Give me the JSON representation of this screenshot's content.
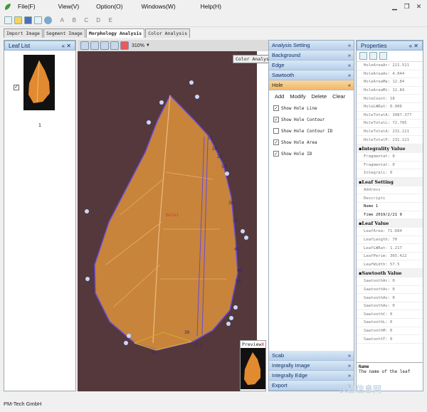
{
  "menu": [
    "File(F)",
    "View(V)",
    "Option(O)",
    "Windows(W)",
    "Help(H)"
  ],
  "toolbar_letters": [
    "A",
    "B",
    "C",
    "D",
    "E"
  ],
  "tabs": [
    "Import Image",
    "Segment Image",
    "Morphology Analysis",
    "Color Analysis"
  ],
  "leaf_list": {
    "title": "Leaf List",
    "item_label": "1",
    "checked": "✓"
  },
  "viewer": {
    "zoom": "310%",
    "color_analysis_button": "Color Analysis",
    "hole_label": "Hole1",
    "preview_title": "Preview",
    "preview_close": "X",
    "contour_numbers": [
      "27",
      "28",
      "29",
      "30",
      "36",
      "37",
      "42",
      "44",
      "50",
      "3",
      "2",
      "30",
      "33"
    ]
  },
  "analysis_setting": {
    "title": "Analysis Setting",
    "sections_top": [
      "Background",
      "Edge",
      "Sawtooth",
      "Hole"
    ],
    "actions": [
      "Add",
      "Modify",
      "Delete",
      "Clear"
    ],
    "checks": [
      {
        "label": "Show Hole Line",
        "checked": true
      },
      {
        "label": "Show Hole Contour",
        "checked": true
      },
      {
        "label": "Show Hole Contour ID",
        "checked": false
      },
      {
        "label": "Show Hole Area",
        "checked": true
      },
      {
        "label": "Show Hole ID",
        "checked": true
      }
    ],
    "sections_bottom": [
      "Scab",
      "Integrally Image",
      "Integrally Edge",
      "Export"
    ]
  },
  "properties": {
    "title": "Properties",
    "rows_top": [
      "HoleAreaAr: 221.521",
      "HoleAreaAv: 4.044",
      "HoleAreaMa: 12.84",
      "HoleAreaMi: 12.84",
      "HoleCount: 18",
      "HoleLWRat: 0.906",
      "HoleTotalA: 3987.377",
      "HoleTotalL: 72.785",
      "HoleTotalA: 231.121",
      "HoleTotalP: 231.121"
    ],
    "cat_integrality": "Integrality Value",
    "rows_integrality": [
      "Fragmentat: 0",
      "Fragmentat: 0",
      "Integrali: 0"
    ],
    "cat_leaf_setting": "Leaf Setting",
    "rows_leaf_setting": [
      "Address",
      "Descripti",
      "Name      1",
      "Time      2019/2/21 9"
    ],
    "cat_leaf_value": "Leaf Value",
    "rows_leaf_value": [
      "LeafArea: 71.684",
      "LeafLength: 70",
      "LeafLWRat: 1.217",
      "LeafPerim: 365.422",
      "LeafWidth: 57.5"
    ],
    "cat_sawtooth": "Sawtooth Value",
    "rows_sawtooth": [
      "SawtoothAr: 0",
      "SawtoothAv: 0",
      "SawtoothAv: 0",
      "SawtoothAv: 0",
      "SawtoothC: 0",
      "SawtoothL: 0",
      "SawtoothM: 0",
      "SawtoothT: 0"
    ],
    "desc_title": "Name",
    "desc_text": "The name of the leaf"
  },
  "status": "PM-Tech GmbH",
  "watermark": "仪器信息网"
}
